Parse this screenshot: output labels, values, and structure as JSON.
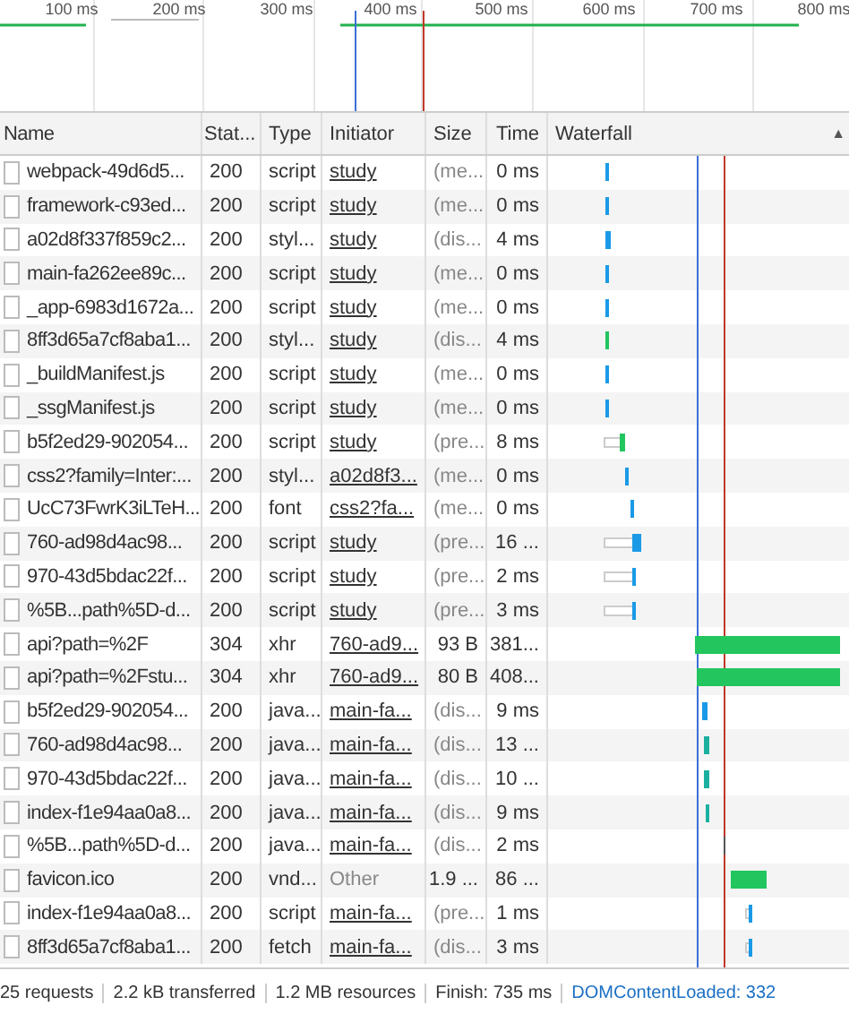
{
  "overview": {
    "ticks": [
      "100 ms",
      "200 ms",
      "300 ms",
      "400 ms",
      "500 ms",
      "600 ms",
      "700 ms",
      "800 ms"
    ]
  },
  "table": {
    "columns": [
      "Name",
      "Stat...",
      "Type",
      "Initiator",
      "Size",
      "Time",
      "Waterfall"
    ],
    "sort_indicator": "▲",
    "rows": [
      {
        "name": "webpack-49d6d5...",
        "status": "200",
        "type": "script",
        "initiator": "study",
        "initiator_link": true,
        "size": "(me...",
        "size_dim": true,
        "time": "0 ms"
      },
      {
        "name": "framework-c93ed...",
        "status": "200",
        "type": "script",
        "initiator": "study",
        "initiator_link": true,
        "size": "(me...",
        "size_dim": true,
        "time": "0 ms"
      },
      {
        "name": "a02d8f337f859c2...",
        "status": "200",
        "type": "styl...",
        "initiator": "study",
        "initiator_link": true,
        "size": "(dis...",
        "size_dim": true,
        "time": "4 ms"
      },
      {
        "name": "main-fa262ee89c...",
        "status": "200",
        "type": "script",
        "initiator": "study",
        "initiator_link": true,
        "size": "(me...",
        "size_dim": true,
        "time": "0 ms"
      },
      {
        "name": "_app-6983d1672a...",
        "status": "200",
        "type": "script",
        "initiator": "study",
        "initiator_link": true,
        "size": "(me...",
        "size_dim": true,
        "time": "0 ms"
      },
      {
        "name": "8ff3d65a7cf8aba1...",
        "status": "200",
        "type": "styl...",
        "initiator": "study",
        "initiator_link": true,
        "size": "(dis...",
        "size_dim": true,
        "time": "4 ms"
      },
      {
        "name": "_buildManifest.js",
        "status": "200",
        "type": "script",
        "initiator": "study",
        "initiator_link": true,
        "size": "(me...",
        "size_dim": true,
        "time": "0 ms"
      },
      {
        "name": "_ssgManifest.js",
        "status": "200",
        "type": "script",
        "initiator": "study",
        "initiator_link": true,
        "size": "(me...",
        "size_dim": true,
        "time": "0 ms"
      },
      {
        "name": "b5f2ed29-902054...",
        "status": "200",
        "type": "script",
        "initiator": "study",
        "initiator_link": true,
        "size": "(pre...",
        "size_dim": true,
        "time": "8 ms"
      },
      {
        "name": "css2?family=Inter:...",
        "status": "200",
        "type": "styl...",
        "initiator": "a02d8f3...",
        "initiator_link": true,
        "size": "(me...",
        "size_dim": true,
        "time": "0 ms"
      },
      {
        "name": "UcC73FwrK3iLTeH...",
        "status": "200",
        "type": "font",
        "initiator": "css2?fa...",
        "initiator_link": true,
        "size": "(me...",
        "size_dim": true,
        "time": "0 ms"
      },
      {
        "name": "760-ad98d4ac98...",
        "status": "200",
        "type": "script",
        "initiator": "study",
        "initiator_link": true,
        "size": "(pre...",
        "size_dim": true,
        "time": "16 ..."
      },
      {
        "name": "970-43d5bdac22f...",
        "status": "200",
        "type": "script",
        "initiator": "study",
        "initiator_link": true,
        "size": "(pre...",
        "size_dim": true,
        "time": "2 ms"
      },
      {
        "name": "%5B...path%5D-d...",
        "status": "200",
        "type": "script",
        "initiator": "study",
        "initiator_link": true,
        "size": "(pre...",
        "size_dim": true,
        "time": "3 ms"
      },
      {
        "name": "api?path=%2F",
        "status": "304",
        "type": "xhr",
        "initiator": "760-ad9...",
        "initiator_link": true,
        "size": "93 B",
        "size_dim": false,
        "time": "381..."
      },
      {
        "name": "api?path=%2Fstu...",
        "status": "304",
        "type": "xhr",
        "initiator": "760-ad9...",
        "initiator_link": true,
        "size": "80 B",
        "size_dim": false,
        "time": "408..."
      },
      {
        "name": "b5f2ed29-902054...",
        "status": "200",
        "type": "java...",
        "initiator": "main-fa...",
        "initiator_link": true,
        "size": "(dis...",
        "size_dim": true,
        "time": "9 ms"
      },
      {
        "name": "760-ad98d4ac98...",
        "status": "200",
        "type": "java...",
        "initiator": "main-fa...",
        "initiator_link": true,
        "size": "(dis...",
        "size_dim": true,
        "time": "13 ..."
      },
      {
        "name": "970-43d5bdac22f...",
        "status": "200",
        "type": "java...",
        "initiator": "main-fa...",
        "initiator_link": true,
        "size": "(dis...",
        "size_dim": true,
        "time": "10 ..."
      },
      {
        "name": "index-f1e94aa0a8...",
        "status": "200",
        "type": "java...",
        "initiator": "main-fa...",
        "initiator_link": true,
        "size": "(dis...",
        "size_dim": true,
        "time": "9 ms"
      },
      {
        "name": "%5B...path%5D-d...",
        "status": "200",
        "type": "java...",
        "initiator": "main-fa...",
        "initiator_link": true,
        "size": "(dis...",
        "size_dim": true,
        "time": "2 ms"
      },
      {
        "name": "favicon.ico",
        "status": "200",
        "type": "vnd...",
        "initiator": "Other",
        "initiator_link": false,
        "size": "1.9 ...",
        "size_dim": false,
        "time": "86 ..."
      },
      {
        "name": "index-f1e94aa0a8...",
        "status": "200",
        "type": "script",
        "initiator": "main-fa...",
        "initiator_link": true,
        "size": "(pre...",
        "size_dim": true,
        "time": "1 ms"
      },
      {
        "name": "8ff3d65a7cf8aba1...",
        "status": "200",
        "type": "fetch",
        "initiator": "main-fa...",
        "initiator_link": true,
        "size": "(dis...",
        "size_dim": true,
        "time": "3 ms"
      }
    ]
  },
  "status_bar": [
    "25 requests",
    "2.2 kB transferred",
    "1.2 MB resources",
    "Finish: 735 ms",
    "DOMContentLoaded: 332"
  ]
}
